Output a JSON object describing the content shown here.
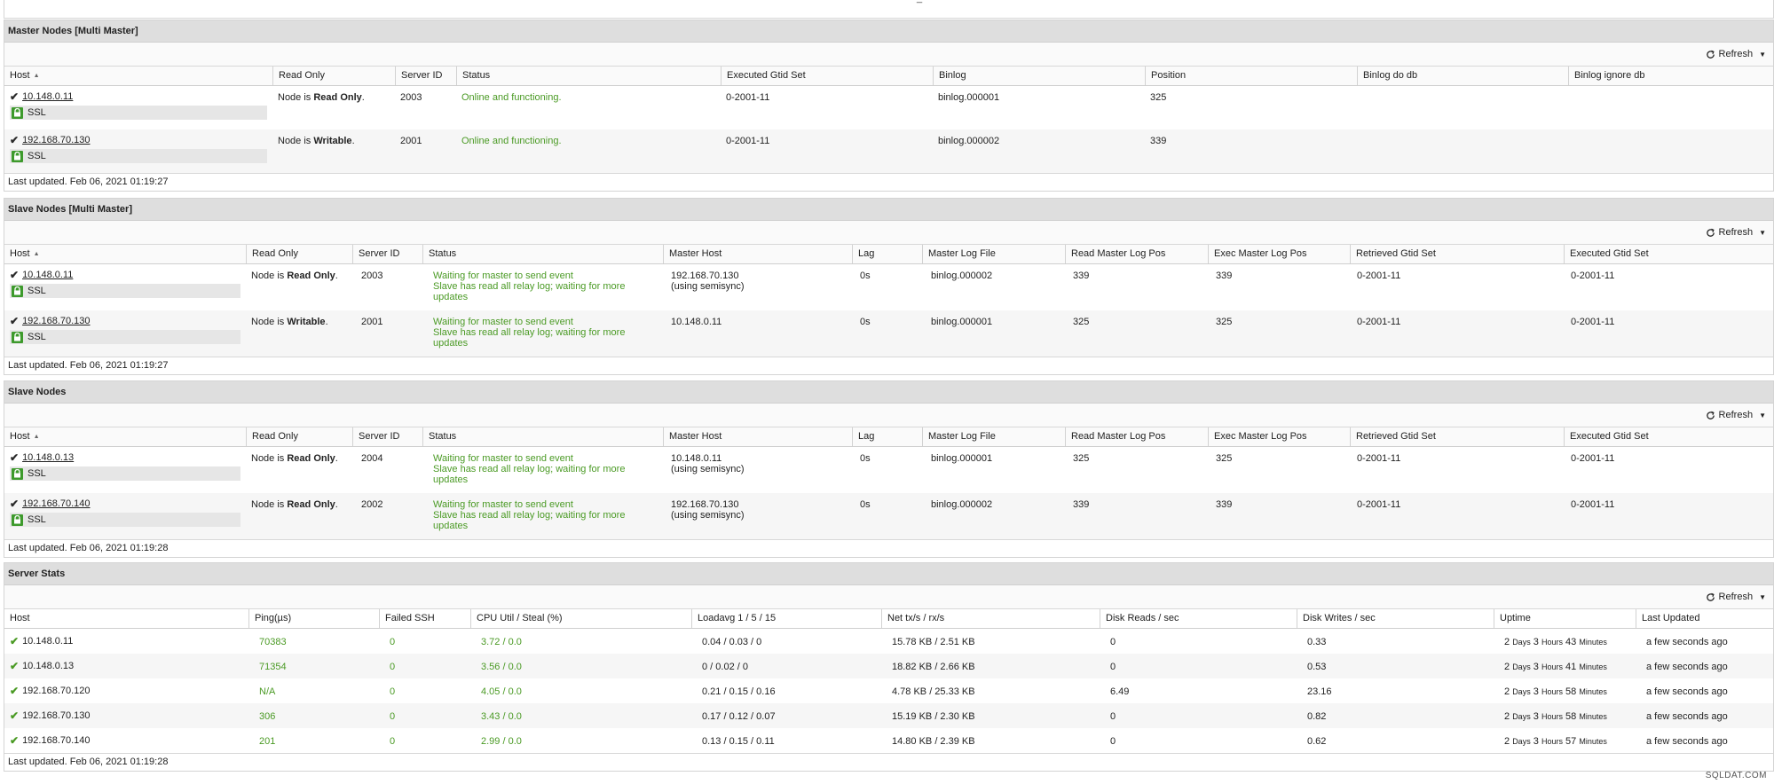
{
  "top_glyph": "_",
  "refresh_label": "Refresh",
  "ssl_label": "SSL",
  "node_is_prefix": "Node is",
  "last_updated_prefix": "Last updated.",
  "master_nodes": {
    "title": "Master Nodes [Multi Master]",
    "headers": [
      "Host",
      "Read Only",
      "Server ID",
      "Status",
      "Executed Gtid Set",
      "Binlog",
      "Position",
      "Binlog do db",
      "Binlog ignore db"
    ],
    "rows": [
      {
        "host": "10.148.0.11",
        "ro": "Read Only",
        "sid": "2003",
        "status": "Online and functioning.",
        "gtid": "0-2001-11",
        "binlog": "binlog.000001",
        "pos": "325"
      },
      {
        "host": "192.168.70.130",
        "ro": "Writable",
        "sid": "2001",
        "status": "Online and functioning.",
        "gtid": "0-2001-11",
        "binlog": "binlog.000002",
        "pos": "339"
      }
    ],
    "updated": "Feb 06, 2021 01:19:27"
  },
  "slave_multi": {
    "title": "Slave Nodes [Multi Master]",
    "headers": [
      "Host",
      "Read Only",
      "Server ID",
      "Status",
      "Master Host",
      "Lag",
      "Master Log File",
      "Read Master Log Pos",
      "Exec Master Log Pos",
      "Retrieved Gtid Set",
      "Executed Gtid Set"
    ],
    "rows": [
      {
        "host": "10.148.0.11",
        "ro": "Read Only",
        "sid": "2003",
        "status1": "Waiting for master to send event",
        "status2": "Slave has read all relay log; waiting for more",
        "status3": "updates",
        "mhost1": "192.168.70.130",
        "mhost2": "(using semisync)",
        "lag": "0s",
        "logfile": "binlog.000002",
        "readpos": "339",
        "execpos": "339",
        "retgtid": "0-2001-11",
        "exegtid": "0-2001-11"
      },
      {
        "host": "192.168.70.130",
        "ro": "Writable",
        "sid": "2001",
        "status1": "Waiting for master to send event",
        "status2": "Slave has read all relay log; waiting for more",
        "status3": "updates",
        "mhost1": "10.148.0.11",
        "mhost2": "",
        "lag": "0s",
        "logfile": "binlog.000001",
        "readpos": "325",
        "execpos": "325",
        "retgtid": "0-2001-11",
        "exegtid": "0-2001-11"
      }
    ],
    "updated": "Feb 06, 2021 01:19:27"
  },
  "slave_nodes": {
    "title": "Slave Nodes",
    "headers": [
      "Host",
      "Read Only",
      "Server ID",
      "Status",
      "Master Host",
      "Lag",
      "Master Log File",
      "Read Master Log Pos",
      "Exec Master Log Pos",
      "Retrieved Gtid Set",
      "Executed Gtid Set"
    ],
    "rows": [
      {
        "host": "10.148.0.13",
        "ro": "Read Only",
        "sid": "2004",
        "status1": "Waiting for master to send event",
        "status2": "Slave has read all relay log; waiting for more",
        "status3": "updates",
        "mhost1": "10.148.0.11",
        "mhost2": "(using semisync)",
        "lag": "0s",
        "logfile": "binlog.000001",
        "readpos": "325",
        "execpos": "325",
        "retgtid": "0-2001-11",
        "exegtid": "0-2001-11"
      },
      {
        "host": "192.168.70.140",
        "ro": "Read Only",
        "sid": "2002",
        "status1": "Waiting for master to send event",
        "status2": "Slave has read all relay log; waiting for more",
        "status3": "updates",
        "mhost1": "192.168.70.130",
        "mhost2": "(using semisync)",
        "lag": "0s",
        "logfile": "binlog.000002",
        "readpos": "339",
        "execpos": "339",
        "retgtid": "0-2001-11",
        "exegtid": "0-2001-11"
      }
    ],
    "updated": "Feb 06, 2021 01:19:28"
  },
  "server_stats": {
    "title": "Server Stats",
    "headers": [
      "Host",
      "Ping(µs)",
      "Failed SSH",
      "CPU Util / Steal (%)",
      "Loadavg 1 / 5 / 15",
      "Net tx/s / rx/s",
      "Disk Reads / sec",
      "Disk Writes / sec",
      "Uptime",
      "Last Updated"
    ],
    "uptime_units": {
      "days": "Days",
      "hours": "Hours",
      "minutes": "Minutes"
    },
    "rows": [
      {
        "host": "10.148.0.11",
        "ping": "70383",
        "ssh": "0",
        "cpu": "3.72 / 0.0",
        "load": "0.04 / 0.03 / 0",
        "net": "15.78 KB / 2.51 KB",
        "dr": "0",
        "dw": "0.33",
        "ud": "2",
        "uh": "3",
        "um": "43",
        "last": "a few seconds ago"
      },
      {
        "host": "10.148.0.13",
        "ping": "71354",
        "ssh": "0",
        "cpu": "3.56 / 0.0",
        "load": "0 / 0.02 / 0",
        "net": "18.82 KB / 2.66 KB",
        "dr": "0",
        "dw": "0.53",
        "ud": "2",
        "uh": "3",
        "um": "41",
        "last": "a few seconds ago"
      },
      {
        "host": "192.168.70.120",
        "ping": "N/A",
        "ssh": "0",
        "cpu": "4.05 / 0.0",
        "load": "0.21 / 0.15 / 0.16",
        "net": "4.78 KB / 25.33 KB",
        "dr": "6.49",
        "dw": "23.16",
        "ud": "2",
        "uh": "3",
        "um": "58",
        "last": "a few seconds ago"
      },
      {
        "host": "192.168.70.130",
        "ping": "306",
        "ssh": "0",
        "cpu": "3.43 / 0.0",
        "load": "0.17 / 0.12 / 0.07",
        "net": "15.19 KB / 2.30 KB",
        "dr": "0",
        "dw": "0.82",
        "ud": "2",
        "uh": "3",
        "um": "58",
        "last": "a few seconds ago"
      },
      {
        "host": "192.168.70.140",
        "ping": "201",
        "ssh": "0",
        "cpu": "2.99 / 0.0",
        "load": "0.13 / 0.15 / 0.11",
        "net": "14.80 KB / 2.39 KB",
        "dr": "0",
        "dw": "0.62",
        "ud": "2",
        "uh": "3",
        "um": "57",
        "last": "a few seconds ago"
      }
    ],
    "updated": "Feb 06, 2021 01:19:28"
  },
  "watermark": "SQLDAT.COM",
  "colors": {
    "accent_green": "#4a9a24",
    "lock_green": "#3d9a2c",
    "header_bg": "#dedede"
  }
}
